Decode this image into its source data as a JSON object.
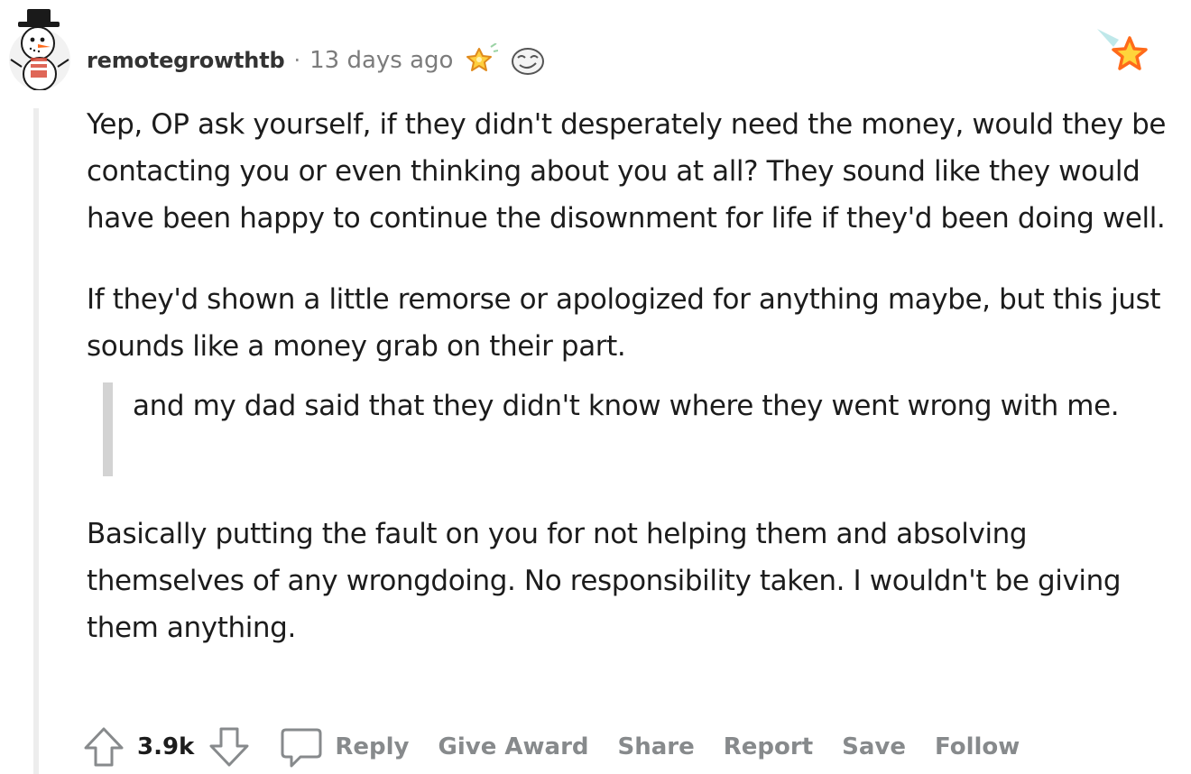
{
  "comment": {
    "username": "remotegrowthtb",
    "separator": "·",
    "timestamp": "13 days ago",
    "paragraphs": [
      "Yep, OP ask yourself, if they didn't desperately need the money, would they be contacting you or even thinking about you at all? They sound like they would have been happy to continue the disownment for life if they'd been doing well.",
      "If they'd shown a little remorse or apologized for anything maybe, but this just sounds like a money grab on their part.",
      "Basically putting the fault on you for not helping them and absolving themselves of any wrongdoing. No responsibility taken. I wouldn't be giving them anything."
    ],
    "quote": "and my dad said that they didn't know where they went wrong with me.",
    "icons": {
      "avatar": "snowman-avatar-icon",
      "awards": [
        "star-burst-award-icon",
        "face-award-icon"
      ],
      "corner_award": "shooting-star-award-icon"
    }
  },
  "actions": {
    "score": "3.9k",
    "reply": "Reply",
    "give_award": "Give Award",
    "share": "Share",
    "report": "Report",
    "save": "Save",
    "follow": "Follow"
  },
  "colors": {
    "text": "#1c1c1c",
    "meta": "#7c7c7c",
    "action": "#878a8c",
    "thread_line": "#ededed",
    "quote_bar": "#d3d3d3",
    "star_orange": "#f5a623",
    "star_red": "#ff4500"
  }
}
